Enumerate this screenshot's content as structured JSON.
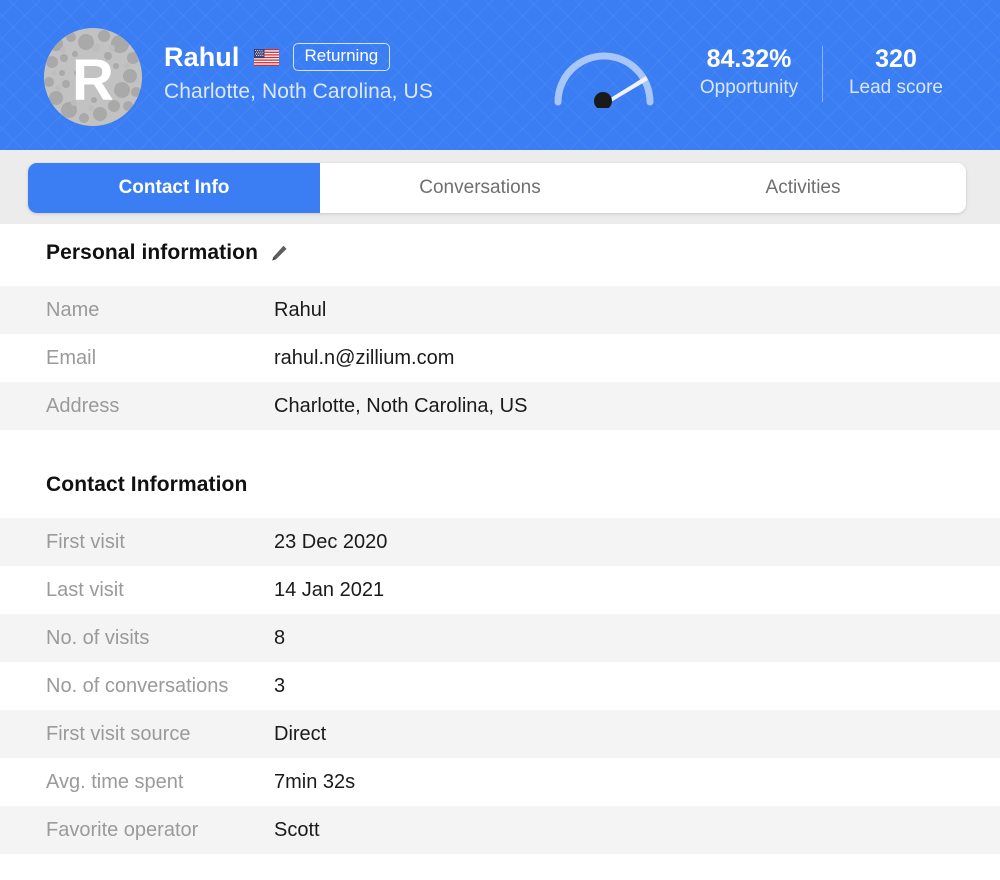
{
  "header": {
    "avatar": {
      "letter": "R",
      "icon": "avatar-bubbles"
    },
    "contact_name": "Rahul",
    "flag": "us-flag-icon",
    "badge": "Returning",
    "location": "Charlotte, Noth Carolina, US",
    "gauge": {
      "icon": "gauge-meter-icon",
      "value_percent": 84.32
    },
    "metrics": [
      {
        "value": "84.32%",
        "label": "Opportunity"
      },
      {
        "value": "320",
        "label": "Lead score"
      }
    ],
    "accent_color": "#3b7ef4"
  },
  "tabs": [
    {
      "label": "Contact Info",
      "active": true
    },
    {
      "label": "Conversations",
      "active": false
    },
    {
      "label": "Activities",
      "active": false
    }
  ],
  "sections": [
    {
      "title": "Personal information",
      "edit_icon": "pencil-icon",
      "rows": [
        {
          "label": "Name",
          "value": "Rahul"
        },
        {
          "label": "Email",
          "value": "rahul.n@zillium.com"
        },
        {
          "label": "Address",
          "value": "Charlotte, Noth Carolina, US"
        }
      ]
    },
    {
      "title": "Contact Information",
      "rows": [
        {
          "label": "First visit",
          "value": "23 Dec 2020"
        },
        {
          "label": "Last visit",
          "value": "14 Jan 2021"
        },
        {
          "label": "No. of visits",
          "value": "8"
        },
        {
          "label": "No. of conversations",
          "value": "3"
        },
        {
          "label": "First visit source",
          "value": "Direct"
        },
        {
          "label": "Avg. time spent",
          "value": "7min 32s"
        },
        {
          "label": "Favorite operator",
          "value": "Scott"
        }
      ]
    }
  ]
}
